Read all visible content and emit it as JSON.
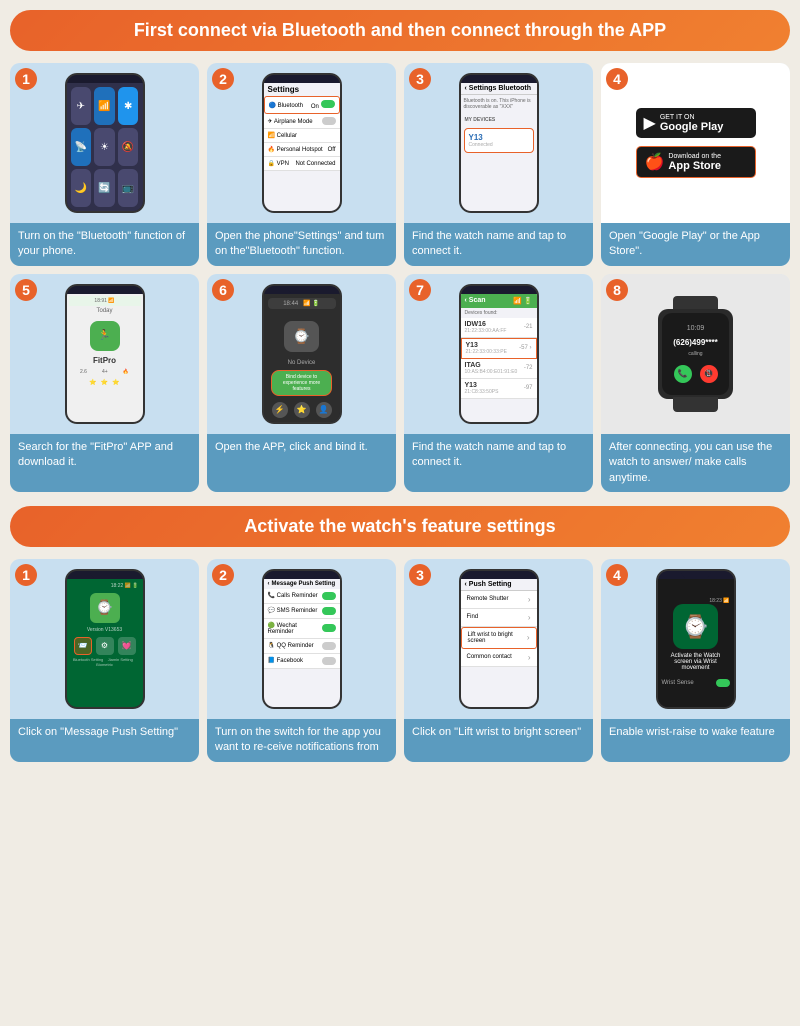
{
  "section1": {
    "header": "First connect via Bluetooth and then connect through the APP",
    "steps": [
      {
        "number": "1",
        "desc": "Turn on the \"Bluetooth\" function of your phone.",
        "type": "bluetooth-toggle"
      },
      {
        "number": "2",
        "desc": "Open the phone\"Settings\" and tum on the\"Bluetooth\" function.",
        "type": "settings-bluetooth"
      },
      {
        "number": "3",
        "desc": "Find the watch name and tap to connect it.",
        "type": "bluetooth-devices",
        "device": "Y13"
      },
      {
        "number": "4",
        "desc": "Open \"Google Play\" or the App Store\".",
        "type": "app-stores"
      },
      {
        "number": "5",
        "desc": "Search for the \"FitPro\" APP and download it.",
        "type": "fitpro-app"
      },
      {
        "number": "6",
        "desc": "Open the APP, click and bind it.",
        "type": "bind-device"
      },
      {
        "number": "7",
        "desc": "Find the watch name and tap to connect it.",
        "type": "device-list"
      },
      {
        "number": "8",
        "desc": "After connecting, you can use the watch to answer/ make calls anytime.",
        "type": "smartwatch-call"
      }
    ]
  },
  "section2": {
    "header": "Activate the watch's feature settings",
    "steps": [
      {
        "number": "1",
        "desc": "Click on \"Message Push Setting\"",
        "type": "msg-push-home"
      },
      {
        "number": "2",
        "desc": "Turn on the switch for the app you want to re-ceive notifications from",
        "type": "msg-push-settings"
      },
      {
        "number": "3",
        "desc": "Click on \"Lift wrist to bright screen\"",
        "type": "lift-wrist"
      },
      {
        "number": "4",
        "desc": "Enable wrist-raise to wake feature",
        "type": "wrist-sense"
      }
    ]
  },
  "ui": {
    "google_play_small": "GET IT ON",
    "google_play_big": "Google Play",
    "app_store_small": "Download on the",
    "app_store_big": "App Store",
    "fitpro_label": "FitPro",
    "no_device": "No Device",
    "bind_device_text": "Bind device to experience more features",
    "bluetooth_header": "Bluetooth",
    "settings_title": "Settings",
    "msg_push_title": "Message Push Setting",
    "lift_wrist_label": "Lift wrist to bright screen",
    "wrist_sense_label": "Wrist Sense",
    "y13_device": "Y13",
    "idw16": "IDW16",
    "itag": "ITAG",
    "call_number": "(626)499****",
    "calling": "calling",
    "calls_reminder": "Calls Reminder",
    "sms_reminder": "SMS Reminder",
    "wechat_reminder": "Wechat Reminder",
    "qq_reminder": "QQ Reminder",
    "facebook": "Facebook",
    "common_contact": "Common contact",
    "remote_shutter": "Remote Shutter",
    "find": "Find",
    "version": "Version V13653"
  }
}
